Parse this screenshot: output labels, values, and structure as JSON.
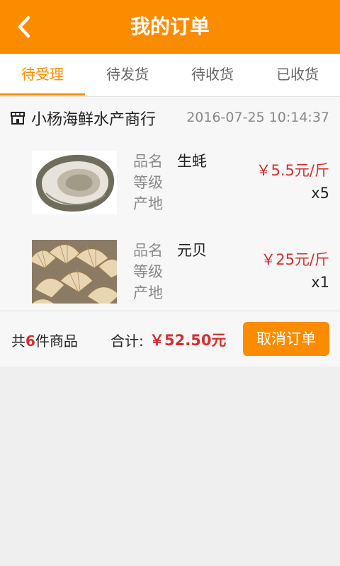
{
  "header": {
    "title": "我的订单"
  },
  "tabs": [
    {
      "label": "待受理"
    },
    {
      "label": "待发货"
    },
    {
      "label": "待收货"
    },
    {
      "label": "已收货"
    }
  ],
  "colors": {
    "accent": "#fb8c00",
    "price": "#d32f2f"
  },
  "order": {
    "shop_name": "小杨海鲜水产商行",
    "time": "2016-07-25 10:14:37",
    "items": [
      {
        "labels": [
          "品名",
          "等级",
          "产地"
        ],
        "name": "生蚝",
        "price": "￥5.5元/斤",
        "qty": "x5",
        "image_icon": "oyster-image"
      },
      {
        "labels": [
          "品名",
          "等级",
          "产地"
        ],
        "name": "元贝",
        "price": "￥25元/斤",
        "qty": "x1",
        "image_icon": "scallop-image"
      }
    ],
    "summary": {
      "count_prefix": "共",
      "count": "6",
      "count_suffix": "件商品",
      "total_label": "合计:",
      "total_value": "￥52.50元"
    },
    "cancel_label": "取消订单"
  }
}
